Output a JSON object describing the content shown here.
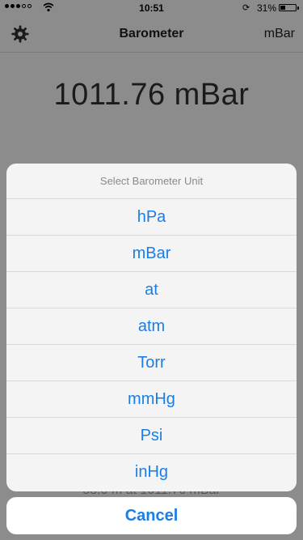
{
  "status_bar": {
    "time": "10:51",
    "battery": "31%",
    "battery_level": 0.31,
    "signal_icon": "signal-dots-icon",
    "wifi_icon": "wifi-icon",
    "rotation_lock_icon": "rotation-lock-icon"
  },
  "nav": {
    "title": "Barometer",
    "unit": "mBar",
    "settings_icon": "gear-icon"
  },
  "main": {
    "reading": "1011.76 mBar",
    "altitude_text": "88.0 m at 1011.76 mBar"
  },
  "sheet": {
    "title": "Select Barometer Unit",
    "options": [
      "hPa",
      "mBar",
      "at",
      "atm",
      "Torr",
      "mmHg",
      "Psi",
      "inHg"
    ],
    "cancel_label": "Cancel"
  },
  "colors": {
    "accent": "#1a7ee6",
    "dim_background": "#8c8c8c",
    "sheet_background": "#f4f4f4"
  }
}
